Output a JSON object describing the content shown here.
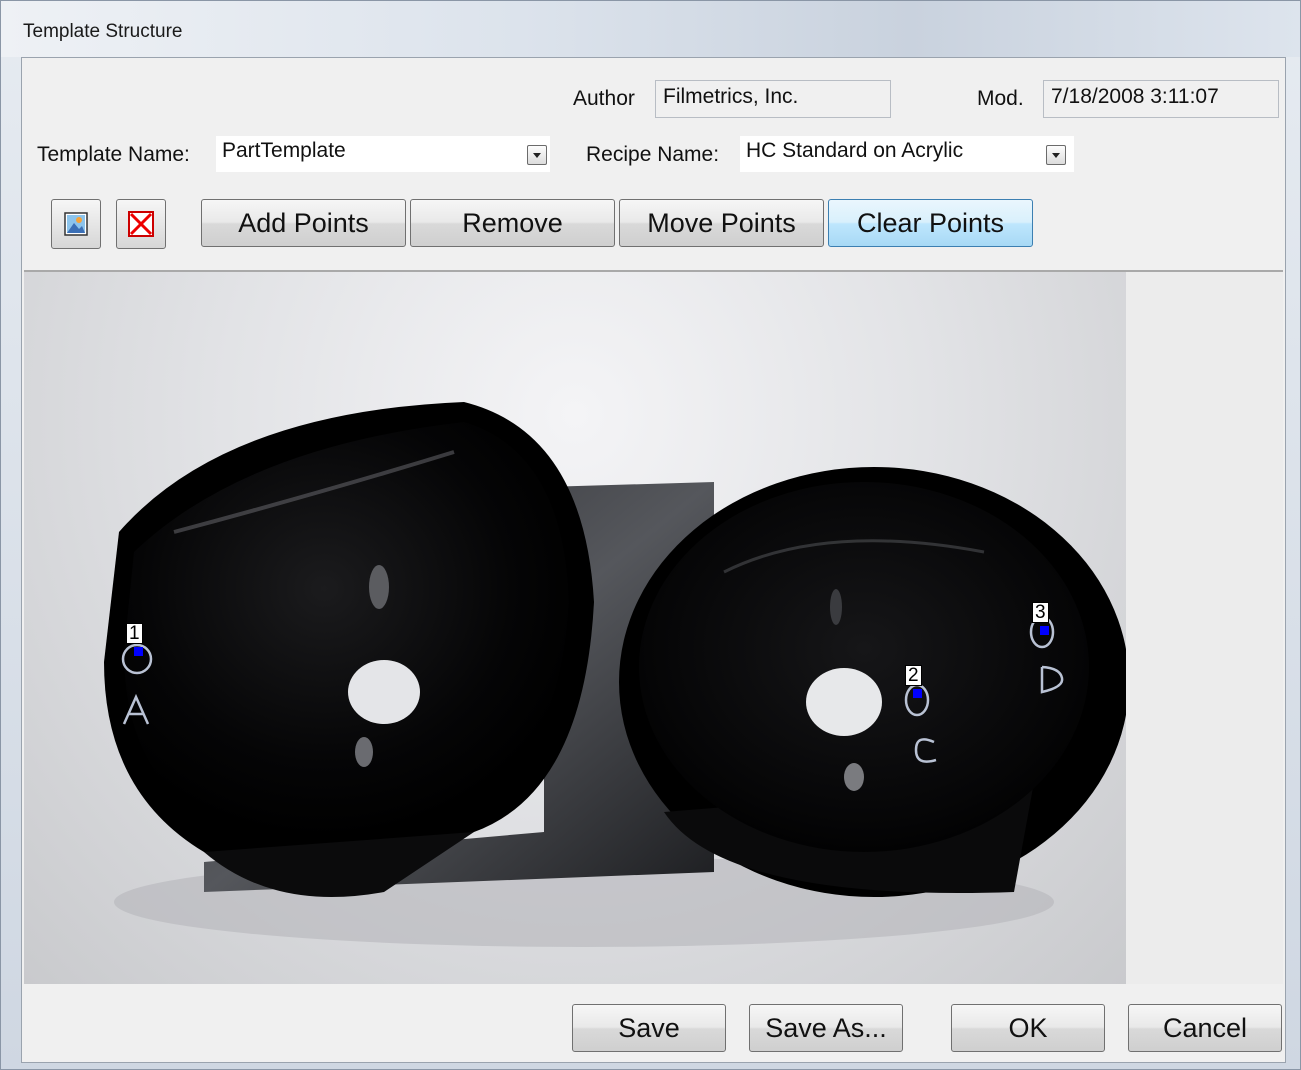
{
  "window": {
    "title": "Template Structure"
  },
  "header": {
    "author_label": "Author",
    "author_value": "Filmetrics, Inc.",
    "mod_label": "Mod.",
    "mod_value": "7/18/2008 3:11:07",
    "template_name_label": "Template Name:",
    "template_name_value": "PartTemplate",
    "recipe_name_label": "Recipe Name:",
    "recipe_name_value": "HC Standard on Acrylic"
  },
  "toolbar": {
    "load_image_icon": "picture-icon",
    "delete_image_icon": "red-x-icon",
    "add_points": "Add Points",
    "remove": "Remove",
    "move_points": "Move Points",
    "clear_points": "Clear Points"
  },
  "image": {
    "points": [
      {
        "label": "1",
        "marker": "A"
      },
      {
        "label": "2",
        "marker": "C"
      },
      {
        "label": "3",
        "marker": "D"
      }
    ]
  },
  "footer": {
    "save": "Save",
    "save_as": "Save As...",
    "ok": "OK",
    "cancel": "Cancel"
  },
  "colors": {
    "point_dot": "#0000ff",
    "focus_button": "#bee6fd"
  }
}
